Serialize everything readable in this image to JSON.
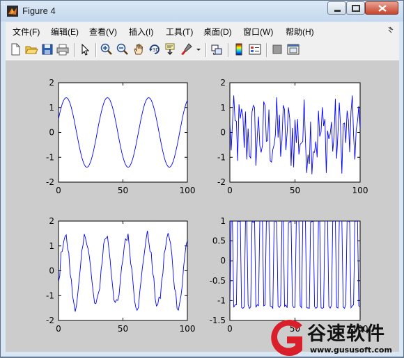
{
  "window": {
    "title": "Figure 4"
  },
  "menu": [
    "文件(F)",
    "编辑(E)",
    "查看(V)",
    "插入(I)",
    "工具(T)",
    "桌面(D)",
    "窗口(W)",
    "帮助(H)"
  ],
  "menu_overflow_icon": "double-chevron-icon",
  "toolbar": {
    "icons": [
      "new-figure-icon",
      "open-file-icon",
      "save-icon",
      "print-icon",
      "edit-plot-arrow-icon",
      "zoom-in-icon",
      "zoom-out-icon",
      "pan-hand-icon",
      "rotate-3d-icon",
      "data-cursor-icon",
      "brush-icon",
      "link-plot-icon",
      "colorbar-icon",
      "legend-icon",
      "hide-plot-tools-icon",
      "show-plot-tools-icon"
    ]
  },
  "colors": {
    "plot_line": "#0000ff",
    "figure_bg": "#cccccc",
    "axes_bg": "#ffffff"
  },
  "chart_data": [
    {
      "type": "line",
      "title": "",
      "xlabel": "",
      "ylabel": "",
      "xlim": [
        0,
        100
      ],
      "ylim": [
        -2,
        2
      ],
      "xticks": [
        "0",
        "50",
        "100"
      ],
      "yticks": [
        "2",
        "1",
        "0",
        "-1",
        "-2"
      ],
      "series": [
        {
          "function": "1.4*sin(2*pi*x/32)",
          "noise": 0
        }
      ]
    },
    {
      "type": "line",
      "title": "",
      "xlabel": "",
      "ylabel": "",
      "xlim": [
        0,
        100
      ],
      "ylim": [
        -2,
        2
      ],
      "xticks": [
        "0",
        "50",
        "100"
      ],
      "yticks": [
        "2",
        "1",
        "0",
        "-1",
        "-2"
      ],
      "series": [
        {
          "description": "random noise",
          "values_range": [
            -1.75,
            1.5
          ]
        }
      ]
    },
    {
      "type": "line",
      "title": "",
      "xlabel": "",
      "ylabel": "",
      "xlim": [
        0,
        100
      ],
      "ylim": [
        -2,
        2
      ],
      "xticks": [
        "0",
        "50",
        "100"
      ],
      "yticks": [
        "2",
        "1",
        "0",
        "-1",
        "-2"
      ],
      "series": [
        {
          "function": "1.4*sin(2*pi*x/16) + noise",
          "noise": 0.25
        }
      ]
    },
    {
      "type": "line",
      "title": "",
      "xlabel": "",
      "ylabel": "",
      "xlim": [
        0,
        100
      ],
      "ylim": [
        -1.5,
        1
      ],
      "xticks": [
        "0",
        "50",
        "100"
      ],
      "yticks": [
        "1",
        "0.5",
        "0",
        "-0.5",
        "-1",
        "-1.5"
      ],
      "series": [
        {
          "description": "square-like wave",
          "values_range": [
            -1.2,
            1.0
          ]
        }
      ]
    }
  ],
  "watermark": {
    "brand": "谷速软件",
    "url": "www.gususoft.com"
  }
}
